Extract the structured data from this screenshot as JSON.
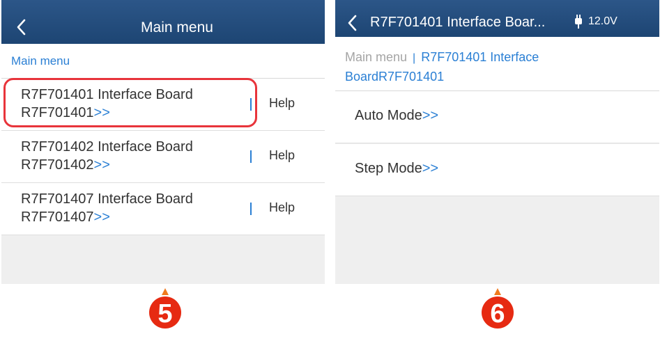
{
  "left": {
    "header": {
      "title": "Main menu"
    },
    "breadcrumb": "Main menu",
    "items": [
      {
        "line1": "R7F701401 Interface Board",
        "line2": "R7F701401",
        "arrow": ">>",
        "help": "Help"
      },
      {
        "line1": "R7F701402 Interface Board",
        "line2": "R7F701402",
        "arrow": ">>",
        "help": "Help"
      },
      {
        "line1": "R7F701407 Interface Board",
        "line2": "R7F701407",
        "arrow": ">>",
        "help": "Help"
      }
    ],
    "step_number": "5"
  },
  "right": {
    "header": {
      "title": "R7F701401 Interface Boar...",
      "battery": "12.0V"
    },
    "breadcrumb": {
      "home": "Main menu",
      "separator": "|",
      "current_line1": "R7F701401 Interface",
      "current_line2": "BoardR7F701401"
    },
    "modes": [
      {
        "label": "Auto Mode",
        "arrow": ">>"
      },
      {
        "label": "Step Mode",
        "arrow": ">>"
      }
    ],
    "step_number": "6"
  },
  "colors": {
    "header": "#1d4573",
    "link_blue": "#2a7fd4",
    "highlight_red": "#e8343b",
    "badge_red": "#e62a12"
  },
  "icons": {
    "back": "chevron-left-icon",
    "battery": "battery-icon",
    "badge": "numbered-badge-icon"
  }
}
